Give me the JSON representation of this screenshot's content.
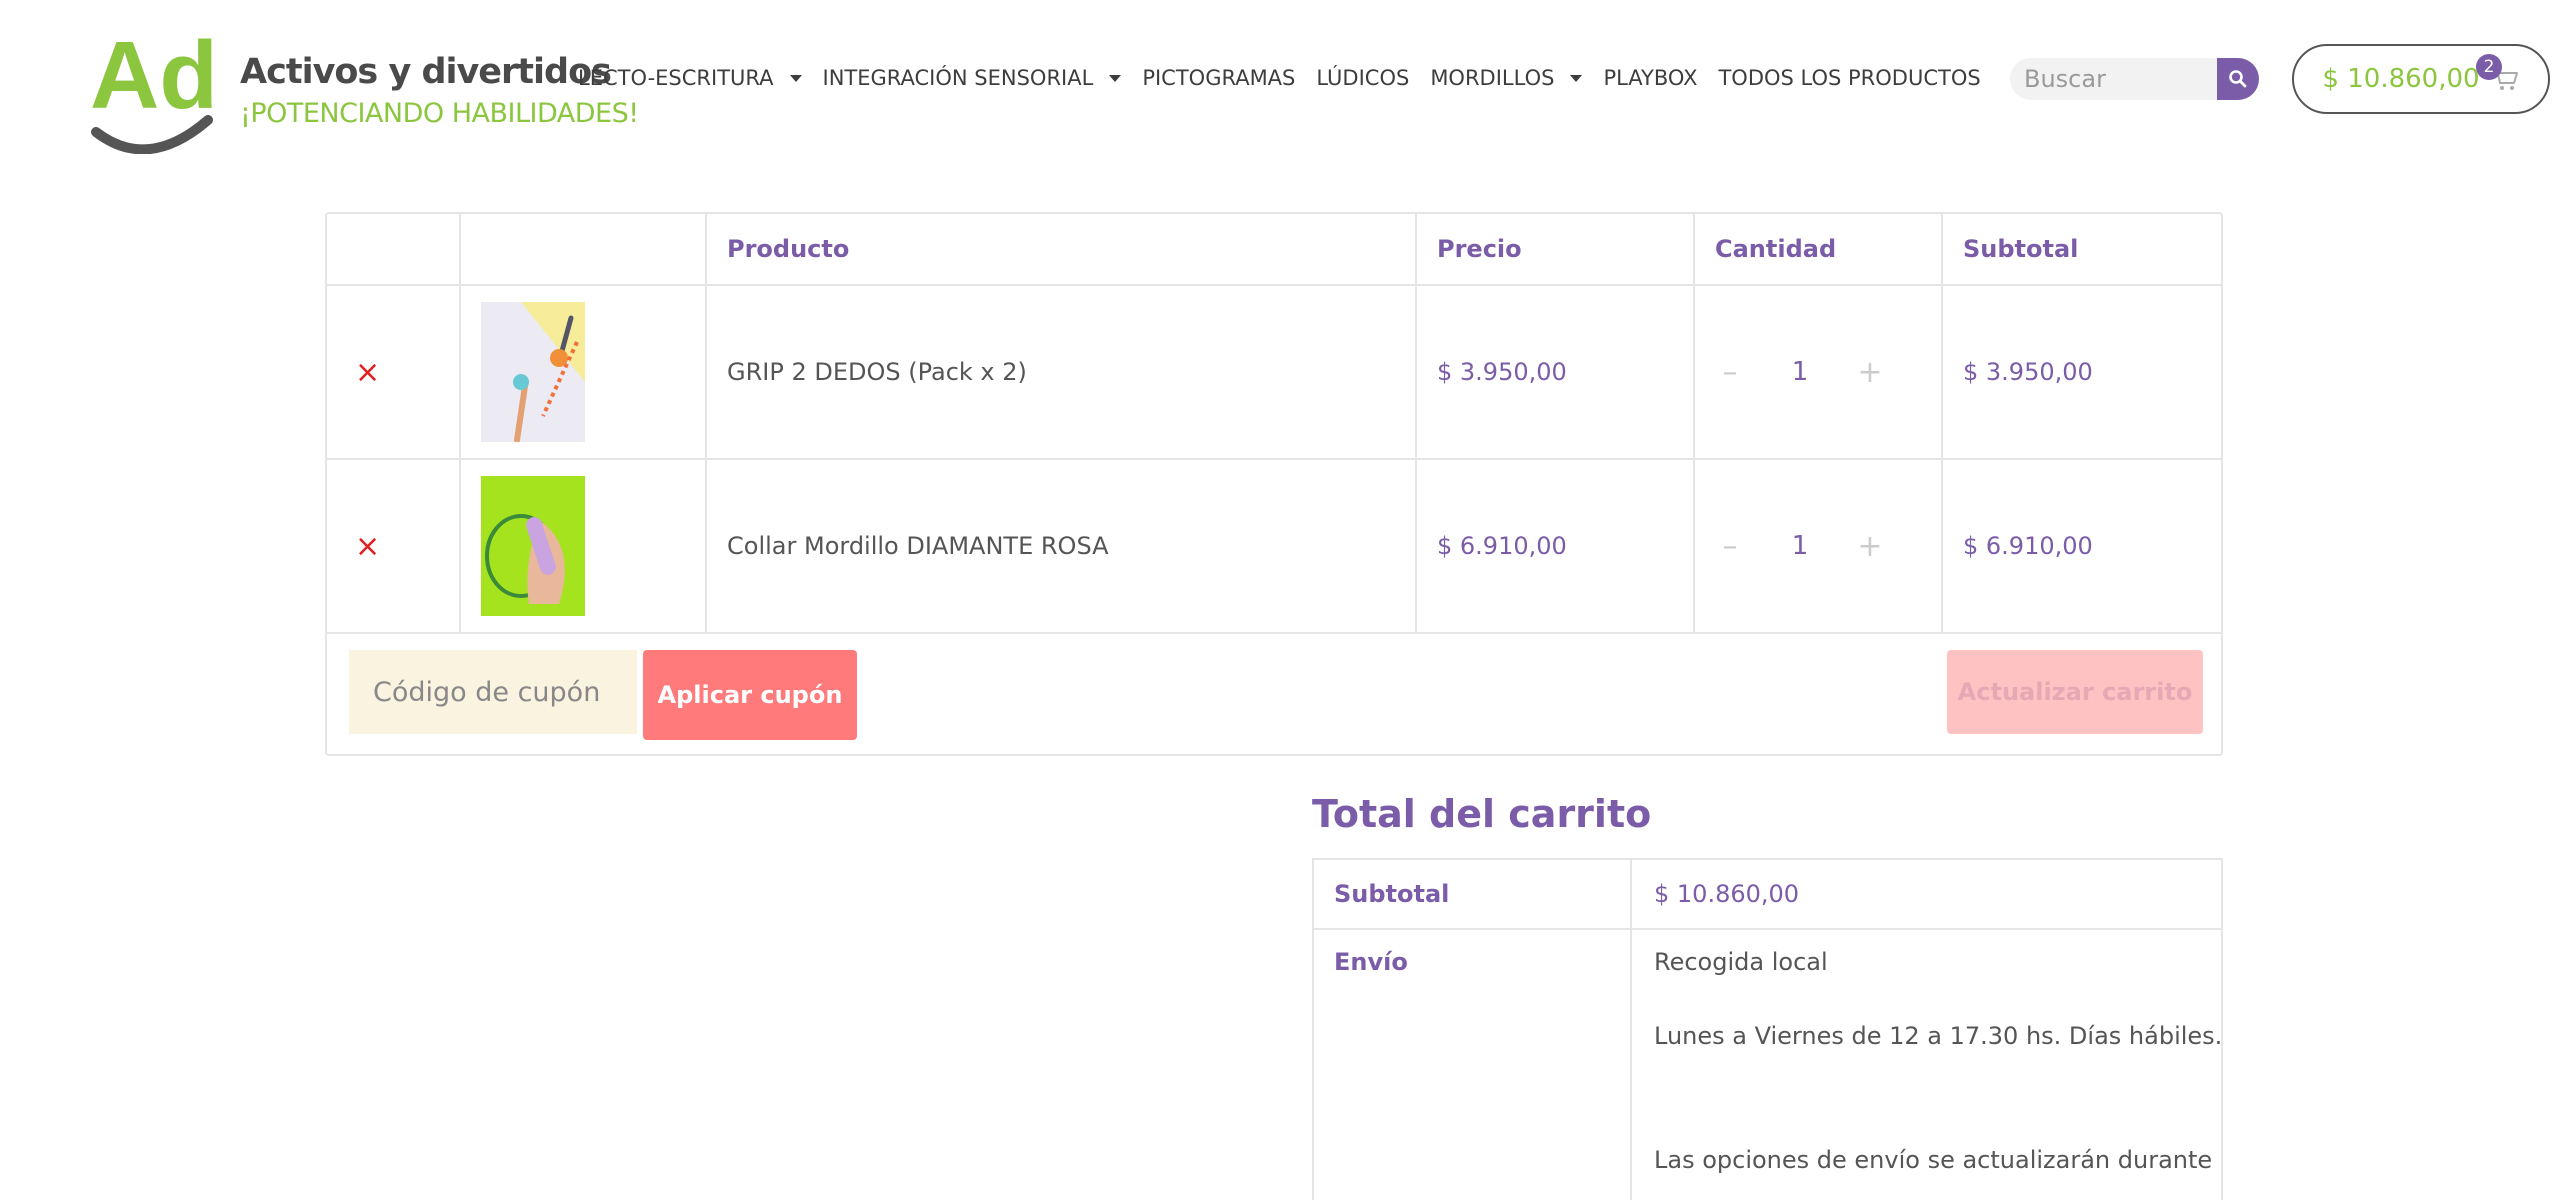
{
  "brand": {
    "logo_letters": "Ad",
    "name": "Activos y divertidos",
    "tagline": "¡POTENCIANDO HABILIDADES!"
  },
  "nav": {
    "items": [
      {
        "label": "LECTO-ESCRITURA",
        "has_dropdown": true
      },
      {
        "label": "INTEGRACIÓN SENSORIAL",
        "has_dropdown": true
      },
      {
        "label": "PICTOGRAMAS",
        "has_dropdown": false
      },
      {
        "label": "LÚDICOS",
        "has_dropdown": false
      },
      {
        "label": "MORDILLOS",
        "has_dropdown": true
      },
      {
        "label": "PLAYBOX",
        "has_dropdown": false
      },
      {
        "label": "TODOS LOS PRODUCTOS",
        "has_dropdown": false
      }
    ]
  },
  "search": {
    "placeholder": "Buscar",
    "icon": "search-icon"
  },
  "mini_cart": {
    "total": "$ 10.860,00",
    "count": "2",
    "icon": "cart-icon"
  },
  "cart": {
    "headers": {
      "product": "Producto",
      "price": "Precio",
      "quantity": "Cantidad",
      "subtotal": "Subtotal"
    },
    "items": [
      {
        "remove": "×",
        "name": "GRIP 2 DEDOS (Pack x 2)",
        "price": "$ 3.950,00",
        "quantity": "1",
        "subtotal": "$ 3.950,00",
        "minus": "–",
        "plus": "+"
      },
      {
        "remove": "×",
        "name": "Collar Mordillo DIAMANTE ROSA",
        "price": "$ 6.910,00",
        "quantity": "1",
        "subtotal": "$ 6.910,00",
        "minus": "–",
        "plus": "+"
      }
    ],
    "coupon_placeholder": "Código de cupón",
    "apply_coupon_label": "Aplicar cupón",
    "update_cart_label": "Actualizar carrito"
  },
  "totals": {
    "title": "Total del carrito",
    "subtotal_label": "Subtotal",
    "subtotal_value": "$ 10.860,00",
    "shipping_label": "Envío",
    "shipping_method": "Recogida local",
    "shipping_hours": "Lunes a Viernes de 12 a 17.30 hs. Días hábiles.",
    "shipping_note": "Las opciones de envío se actualizarán durante"
  },
  "colors": {
    "brand_green": "#8cc63f",
    "brand_purple": "#7a5ca8",
    "coupon_button": "#ff7b7b",
    "remove_red": "#e02020"
  }
}
